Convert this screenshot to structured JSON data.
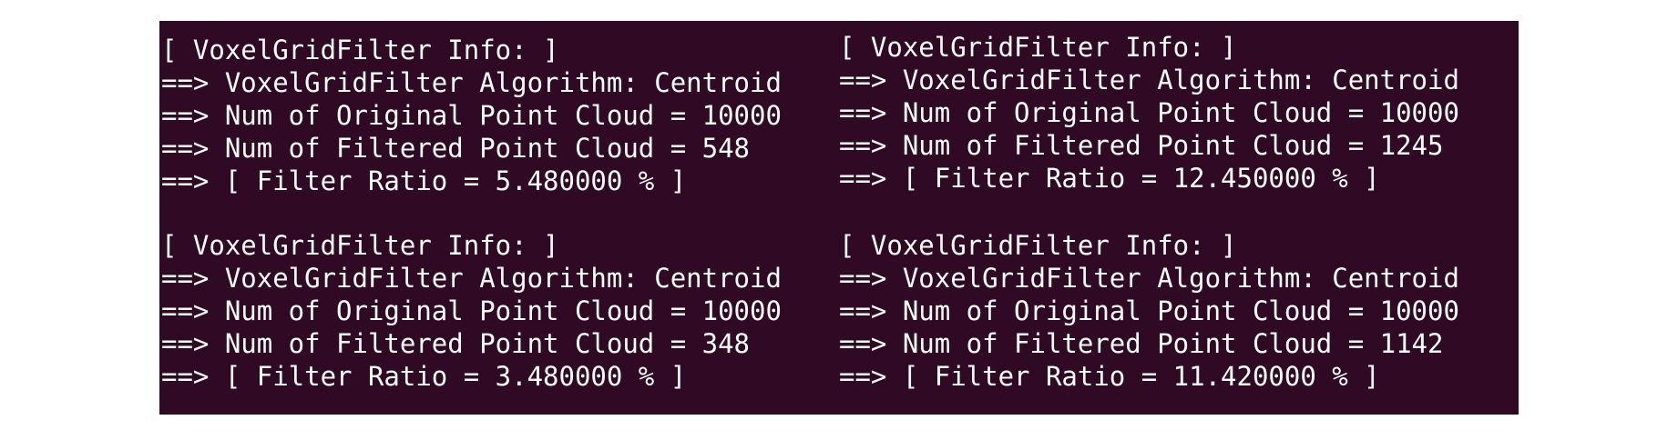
{
  "terminal": {
    "background": "#300a24",
    "text_color": "#ffffff",
    "blocks": [
      {
        "header": "[ VoxelGridFilter Info: ]",
        "algorithm": "==> VoxelGridFilter Algorithm: Centroid",
        "original": "==> Num of Original Point Cloud = 10000",
        "filtered": "==> Num of Filtered Point Cloud = 548",
        "ratio": "==> [ Filter Ratio = 5.480000 % ]"
      },
      {
        "header": "[ VoxelGridFilter Info: ]",
        "algorithm": "==> VoxelGridFilter Algorithm: Centroid",
        "original": "==> Num of Original Point Cloud = 10000",
        "filtered": "==> Num of Filtered Point Cloud = 1245",
        "ratio": "==> [ Filter Ratio = 12.450000 % ]"
      },
      {
        "header": "[ VoxelGridFilter Info: ]",
        "algorithm": "==> VoxelGridFilter Algorithm: Centroid",
        "original": "==> Num of Original Point Cloud = 10000",
        "filtered": "==> Num of Filtered Point Cloud = 348",
        "ratio": "==> [ Filter Ratio = 3.480000 % ]"
      },
      {
        "header": "[ VoxelGridFilter Info: ]",
        "algorithm": "==> VoxelGridFilter Algorithm: Centroid",
        "original": "==> Num of Original Point Cloud = 10000",
        "filtered": "==> Num of Filtered Point Cloud = 1142",
        "ratio": "==> [ Filter Ratio = 11.420000 % ]"
      }
    ]
  }
}
